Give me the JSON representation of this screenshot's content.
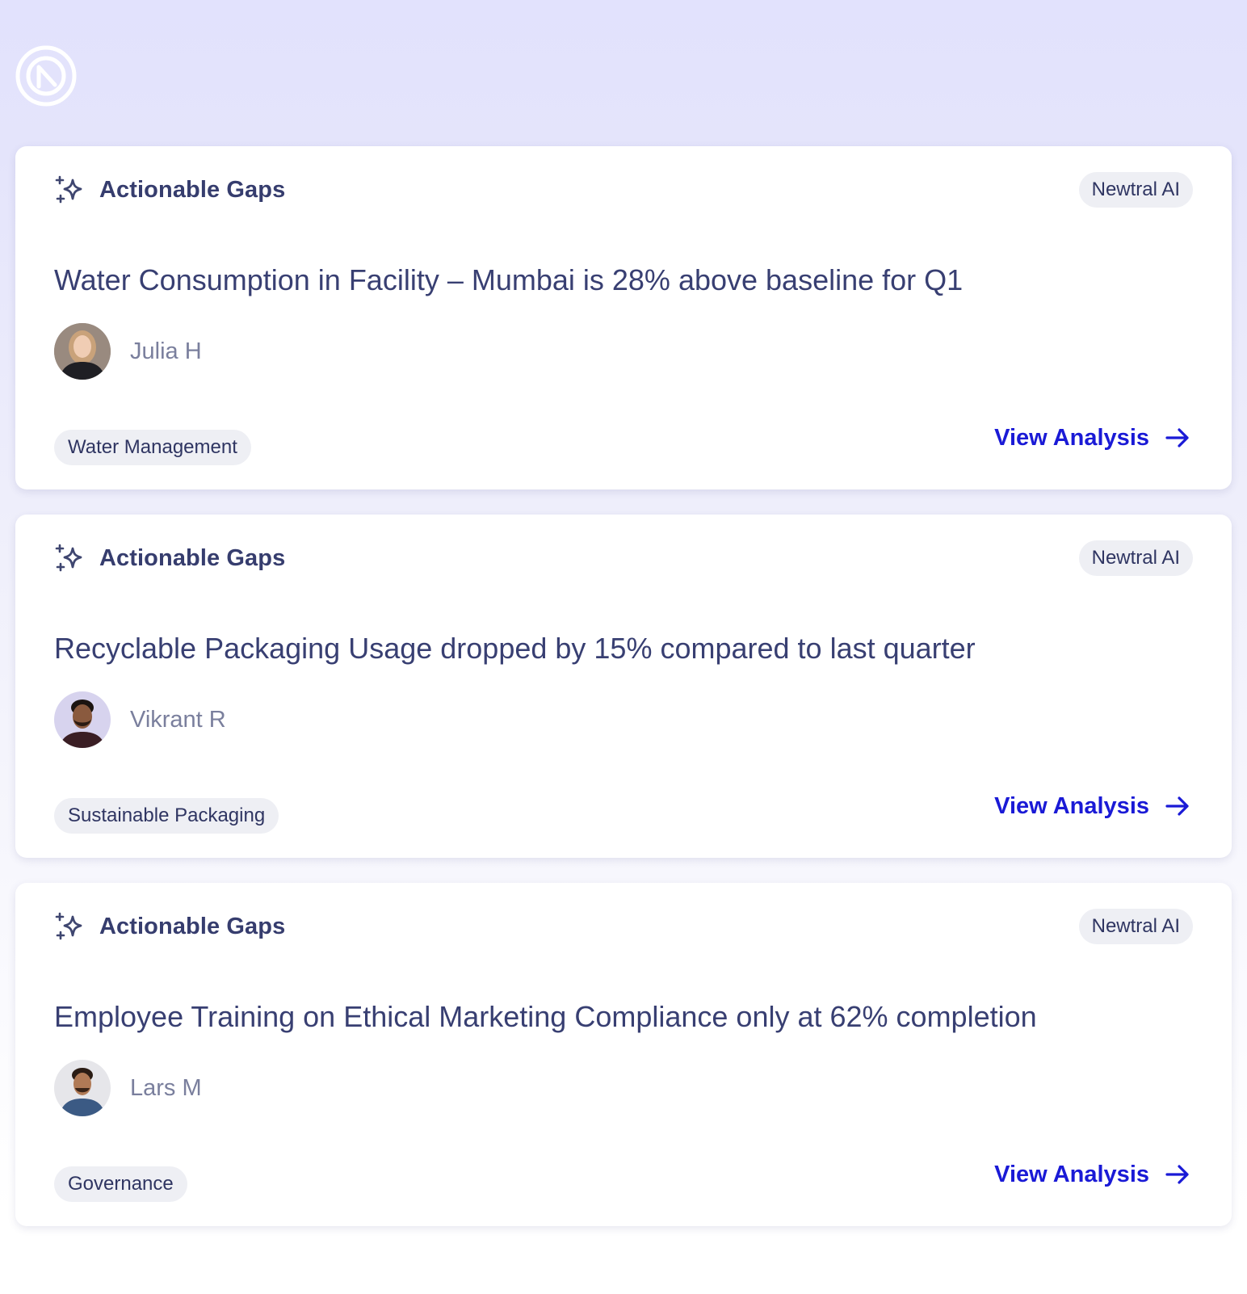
{
  "logo": {
    "icon": "newtral-logo-icon"
  },
  "cards": [
    {
      "section_label": "Actionable Gaps",
      "section_icon": "sparkle-icon",
      "badge": "Newtral AI",
      "title": "Water Consumption in Facility – Mumbai is 28% above baseline for Q1",
      "owner": "Julia H",
      "tag": "Water Management",
      "action": "View Analysis"
    },
    {
      "section_label": "Actionable Gaps",
      "section_icon": "sparkle-icon",
      "badge": "Newtral AI",
      "title": "Recyclable Packaging Usage dropped by 15% compared to last quarter",
      "owner": "Vikrant R",
      "tag": "Sustainable Packaging",
      "action": "View Analysis"
    },
    {
      "section_label": "Actionable Gaps",
      "section_icon": "sparkle-icon",
      "badge": "Newtral AI",
      "title": "Employee Training on Ethical Marketing Compliance only at 62% completion",
      "owner": "Lars M",
      "tag": "Governance",
      "action": "View Analysis"
    }
  ],
  "colors": {
    "accent": "#1a1ad6",
    "text": "#383f72",
    "muted": "#7a7f9d",
    "badge_bg": "#eeeff4",
    "background": "#e2e2fd"
  }
}
